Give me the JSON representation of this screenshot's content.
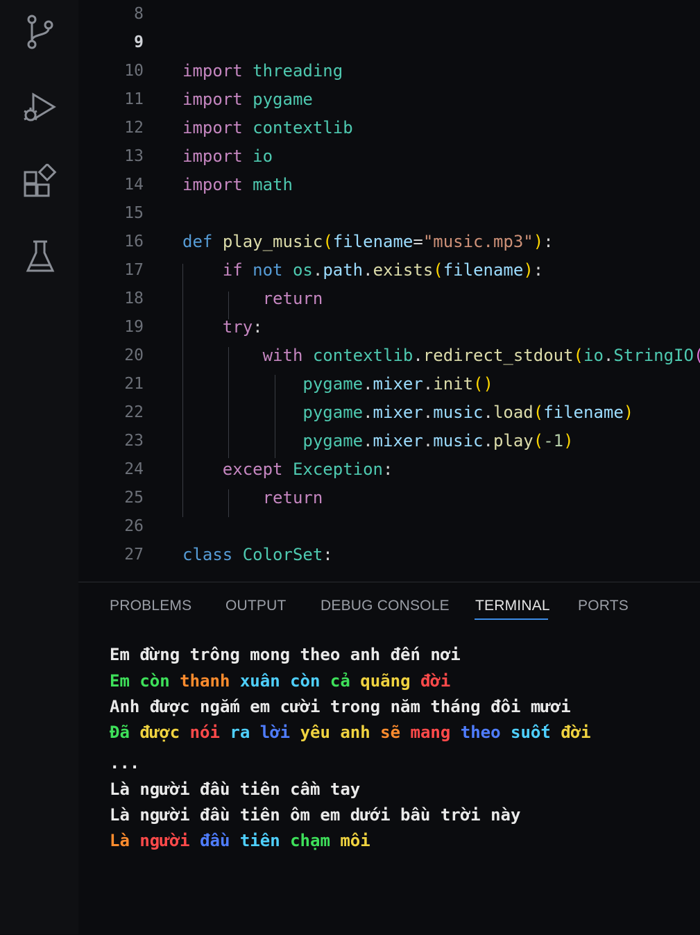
{
  "editor": {
    "lines": [
      {
        "num": "8"
      },
      {
        "num": "9",
        "active": true
      },
      {
        "num": "10",
        "tokens": [
          [
            "kw",
            "import"
          ],
          [
            "plain",
            " "
          ],
          [
            "mod",
            "threading"
          ]
        ]
      },
      {
        "num": "11",
        "tokens": [
          [
            "kw",
            "import"
          ],
          [
            "plain",
            " "
          ],
          [
            "mod",
            "pygame"
          ]
        ]
      },
      {
        "num": "12",
        "tokens": [
          [
            "kw",
            "import"
          ],
          [
            "plain",
            " "
          ],
          [
            "mod",
            "contextlib"
          ]
        ]
      },
      {
        "num": "13",
        "tokens": [
          [
            "kw",
            "import"
          ],
          [
            "plain",
            " "
          ],
          [
            "mod",
            "io"
          ]
        ]
      },
      {
        "num": "14",
        "tokens": [
          [
            "kw",
            "import"
          ],
          [
            "plain",
            " "
          ],
          [
            "mod",
            "math"
          ]
        ]
      },
      {
        "num": "15"
      },
      {
        "num": "16",
        "tokens": [
          [
            "kw-blue",
            "def"
          ],
          [
            "plain",
            " "
          ],
          [
            "fn",
            "play_music"
          ],
          [
            "p1",
            "("
          ],
          [
            "var",
            "filename"
          ],
          [
            "plain",
            "="
          ],
          [
            "str",
            "\"music.mp3\""
          ],
          [
            "p1",
            ")"
          ],
          [
            "plain",
            ":"
          ]
        ]
      },
      {
        "num": "17",
        "tokens": [
          [
            "plain",
            "    "
          ],
          [
            "kw",
            "if"
          ],
          [
            "plain",
            " "
          ],
          [
            "kw-blue",
            "not"
          ],
          [
            "plain",
            " "
          ],
          [
            "mod",
            "os"
          ],
          [
            "plain",
            "."
          ],
          [
            "var",
            "path"
          ],
          [
            "plain",
            "."
          ],
          [
            "fn",
            "exists"
          ],
          [
            "p1",
            "("
          ],
          [
            "var",
            "filename"
          ],
          [
            "p1",
            ")"
          ],
          [
            "plain",
            ":"
          ]
        ]
      },
      {
        "num": "18",
        "tokens": [
          [
            "plain",
            "        "
          ],
          [
            "kw",
            "return"
          ]
        ]
      },
      {
        "num": "19",
        "tokens": [
          [
            "plain",
            "    "
          ],
          [
            "kw",
            "try"
          ],
          [
            "plain",
            ":"
          ]
        ]
      },
      {
        "num": "20",
        "tokens": [
          [
            "plain",
            "        "
          ],
          [
            "kw",
            "with"
          ],
          [
            "plain",
            " "
          ],
          [
            "mod",
            "contextlib"
          ],
          [
            "plain",
            "."
          ],
          [
            "fn",
            "redirect_stdout"
          ],
          [
            "p1",
            "("
          ],
          [
            "mod",
            "io"
          ],
          [
            "plain",
            "."
          ],
          [
            "mod",
            "StringIO"
          ],
          [
            "p2",
            "("
          ],
          [
            "p2",
            ")"
          ],
          [
            "p1",
            ")"
          ],
          [
            "plain",
            ":"
          ]
        ]
      },
      {
        "num": "21",
        "tokens": [
          [
            "plain",
            "            "
          ],
          [
            "mod",
            "pygame"
          ],
          [
            "plain",
            "."
          ],
          [
            "var",
            "mixer"
          ],
          [
            "plain",
            "."
          ],
          [
            "fn",
            "init"
          ],
          [
            "p1",
            "()"
          ]
        ]
      },
      {
        "num": "22",
        "tokens": [
          [
            "plain",
            "            "
          ],
          [
            "mod",
            "pygame"
          ],
          [
            "plain",
            "."
          ],
          [
            "var",
            "mixer"
          ],
          [
            "plain",
            "."
          ],
          [
            "var",
            "music"
          ],
          [
            "plain",
            "."
          ],
          [
            "fn",
            "load"
          ],
          [
            "p1",
            "("
          ],
          [
            "var",
            "filename"
          ],
          [
            "p1",
            ")"
          ]
        ]
      },
      {
        "num": "23",
        "tokens": [
          [
            "plain",
            "            "
          ],
          [
            "mod",
            "pygame"
          ],
          [
            "plain",
            "."
          ],
          [
            "var",
            "mixer"
          ],
          [
            "plain",
            "."
          ],
          [
            "var",
            "music"
          ],
          [
            "plain",
            "."
          ],
          [
            "fn",
            "play"
          ],
          [
            "p1",
            "("
          ],
          [
            "num",
            "-1"
          ],
          [
            "p1",
            ")"
          ]
        ]
      },
      {
        "num": "24",
        "tokens": [
          [
            "plain",
            "    "
          ],
          [
            "kw",
            "except"
          ],
          [
            "plain",
            " "
          ],
          [
            "mod",
            "Exception"
          ],
          [
            "plain",
            ":"
          ]
        ]
      },
      {
        "num": "25",
        "tokens": [
          [
            "plain",
            "        "
          ],
          [
            "kw",
            "return"
          ]
        ]
      },
      {
        "num": "26"
      },
      {
        "num": "27",
        "tokens": [
          [
            "kw-blue",
            "class"
          ],
          [
            "plain",
            " "
          ],
          [
            "mod",
            "ColorSet"
          ],
          [
            "plain",
            ":"
          ]
        ]
      }
    ]
  },
  "panel": {
    "tabs": [
      {
        "label": "PROBLEMS"
      },
      {
        "label": "OUTPUT"
      },
      {
        "label": "DEBUG CONSOLE"
      },
      {
        "label": "TERMINAL",
        "active": true
      },
      {
        "label": "PORTS"
      }
    ],
    "terminal": [
      [
        [
          "white",
          "Em đừng trông mong theo anh đến nơi"
        ]
      ],
      [
        [
          "green",
          "Em còn "
        ],
        [
          "orange",
          "thanh "
        ],
        [
          "cyan",
          "xuân "
        ],
        [
          "cyan",
          "còn "
        ],
        [
          "green",
          "cả "
        ],
        [
          "yellow",
          "quãng "
        ],
        [
          "red",
          "đời"
        ]
      ],
      [
        [
          "white",
          "Anh được ngắm em cười trong năm tháng đôi mươi"
        ]
      ],
      [
        [
          "green",
          "Đã "
        ],
        [
          "yellow",
          "được "
        ],
        [
          "red",
          "nói "
        ],
        [
          "cyan",
          "ra "
        ],
        [
          "blue",
          "lời "
        ],
        [
          "yellow",
          "yêu "
        ],
        [
          "yellow",
          "anh "
        ],
        [
          "orange",
          "sẽ "
        ],
        [
          "red",
          "mang "
        ],
        [
          "blue",
          "theo "
        ],
        [
          "cyan",
          "suốt "
        ],
        [
          "yellow",
          "đời"
        ]
      ],
      [
        [
          "white",
          "..."
        ]
      ],
      [
        [
          "white",
          "Là người đầu tiên cầm tay"
        ]
      ],
      [
        [
          "white",
          "Là người đầu tiên ôm em dưới bầu trời này"
        ]
      ],
      [
        [
          "orange",
          "Là "
        ],
        [
          "red",
          "người "
        ],
        [
          "blue",
          "đầu "
        ],
        [
          "cyan",
          "tiên "
        ],
        [
          "green",
          "chạm "
        ],
        [
          "yellow",
          "môi"
        ]
      ]
    ]
  },
  "activity_bar": {
    "icons": [
      "source-control-icon",
      "run-debug-icon",
      "extensions-icon",
      "testing-icon"
    ]
  }
}
